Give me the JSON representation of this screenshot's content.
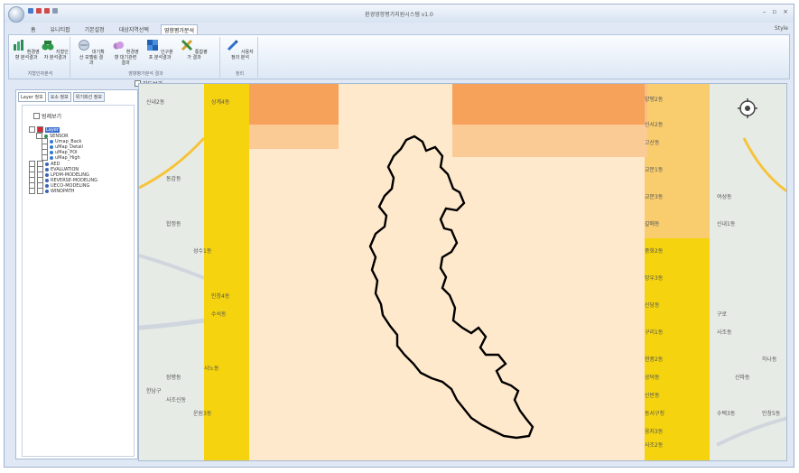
{
  "window": {
    "title": "환경영향평가지원시스템 v1.0",
    "controls": [
      "–",
      "▫",
      "×"
    ],
    "style_label": "Style"
  },
  "ribbon": {
    "tabs": [
      "홈",
      "유니티팝",
      "기본설정",
      "대상지역선택",
      "영향평가분석"
    ],
    "active_tab": "영향평가분석",
    "groups": [
      {
        "caption": "지형인자분석",
        "buttons": [
          "환경영향 분석결과",
          "지형인자 분석결과"
        ]
      },
      {
        "caption": "영향평가분석 결과",
        "buttons": [
          "대기확산 모델링 결과",
          "환경영향 대기관련 결과",
          "인구분포 분석결과",
          "통합평가 결과"
        ]
      },
      {
        "caption": "정리",
        "buttons": [
          "사용자 정의 분석"
        ]
      }
    ]
  },
  "left_panel": {
    "tabs": [
      "Layer 정보",
      "요소 정보",
      "위기회선 정보"
    ],
    "active_tab": "Layer 정보",
    "checkbox_label": "범례보기",
    "tree": {
      "root": "Layer",
      "sensor": "SENSOR",
      "items": [
        "Umap_Back",
        "uMap_Detail",
        "uMap_POI",
        "uMap_High"
      ],
      "groups": [
        "AED",
        "EVALUATION",
        "LPDM-MODELING",
        "REVERSE-MODELING",
        "UECO-MODELING",
        "WINDPATH"
      ]
    }
  },
  "map": {
    "checkbox_label": "지도보기",
    "labels": [
      "신내2동",
      "상계4동",
      "양평2동",
      "신사2동",
      "고산동",
      "교문1동",
      "교문3동",
      "갈매동",
      "여성동",
      "신내1동",
      "중화2동",
      "망우3동",
      "신당동",
      "구리1동",
      "구로",
      "사조동",
      "현풍2동",
      "공덕동",
      "신반동",
      "동서구청",
      "웅지3동",
      "사조2동",
      "수택3동",
      "신파동",
      "하나동",
      "한남구",
      "장평동",
      "사노동",
      "수석동",
      "인창4동",
      "합정동",
      "동감동",
      "성수1동",
      "사조신동",
      "운원3동",
      "인창5동"
    ],
    "colors": {
      "base": "#ffe9cc",
      "high": "#ec7d1f",
      "mid": "#f6a25a",
      "low": "#fbcb96",
      "edge": "#f5d30e",
      "boundary": "#000000"
    }
  }
}
